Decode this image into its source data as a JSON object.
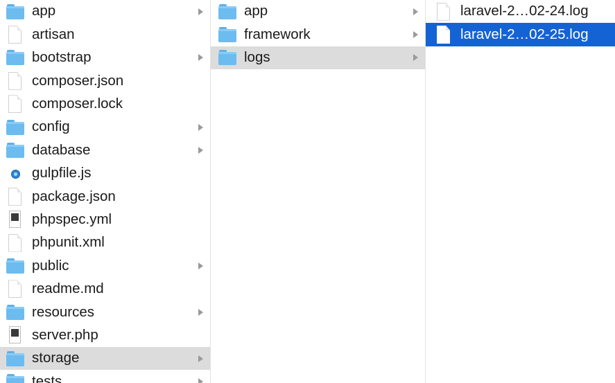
{
  "columns": [
    {
      "items": [
        {
          "label": "app",
          "icon": "folder",
          "arrow": true,
          "state": ""
        },
        {
          "label": "artisan",
          "icon": "doc",
          "arrow": false,
          "state": ""
        },
        {
          "label": "bootstrap",
          "icon": "folder",
          "arrow": true,
          "state": ""
        },
        {
          "label": "composer.json",
          "icon": "doc",
          "arrow": false,
          "state": ""
        },
        {
          "label": "composer.lock",
          "icon": "doc",
          "arrow": false,
          "state": ""
        },
        {
          "label": "config",
          "icon": "folder",
          "arrow": true,
          "state": ""
        },
        {
          "label": "database",
          "icon": "folder",
          "arrow": true,
          "state": ""
        },
        {
          "label": "gulpfile.js",
          "icon": "js",
          "arrow": false,
          "state": ""
        },
        {
          "label": "package.json",
          "icon": "doc",
          "arrow": false,
          "state": ""
        },
        {
          "label": "phpspec.yml",
          "icon": "bin",
          "tag": "YML",
          "arrow": false,
          "state": ""
        },
        {
          "label": "phpunit.xml",
          "icon": "doc",
          "arrow": false,
          "state": ""
        },
        {
          "label": "public",
          "icon": "folder",
          "arrow": true,
          "state": ""
        },
        {
          "label": "readme.md",
          "icon": "doc",
          "arrow": false,
          "state": ""
        },
        {
          "label": "resources",
          "icon": "folder",
          "arrow": true,
          "state": ""
        },
        {
          "label": "server.php",
          "icon": "bin",
          "tag": "PHP",
          "arrow": false,
          "state": ""
        },
        {
          "label": "storage",
          "icon": "folder",
          "arrow": true,
          "state": "sel-gray"
        },
        {
          "label": "tests",
          "icon": "folder",
          "arrow": true,
          "state": ""
        }
      ]
    },
    {
      "items": [
        {
          "label": "app",
          "icon": "folder",
          "arrow": true,
          "state": ""
        },
        {
          "label": "framework",
          "icon": "folder",
          "arrow": true,
          "state": ""
        },
        {
          "label": "logs",
          "icon": "folder",
          "arrow": true,
          "state": "sel-gray"
        }
      ]
    },
    {
      "items": [
        {
          "label": "laravel-2…02-24.log",
          "icon": "doc",
          "arrow": false,
          "state": ""
        },
        {
          "label": "laravel-2…02-25.log",
          "icon": "doc",
          "arrow": false,
          "state": "sel-blue"
        }
      ]
    }
  ],
  "colors": {
    "folder": "#6cbcf0",
    "selection_active": "#1463d4",
    "selection_inactive": "#dcdcdc"
  }
}
